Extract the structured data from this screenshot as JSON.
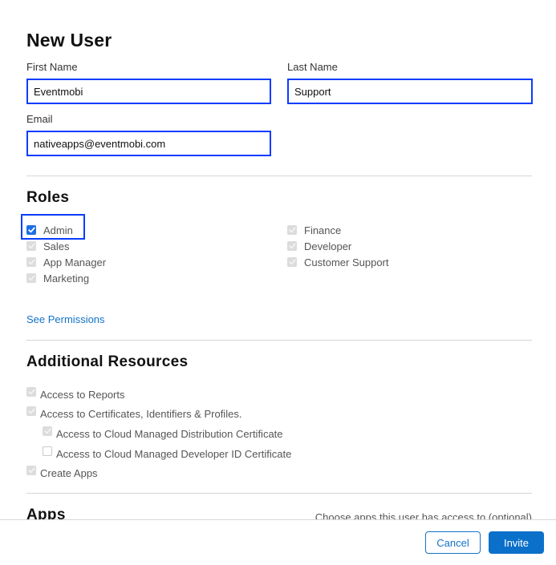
{
  "title": "New User",
  "form": {
    "first_name": {
      "label": "First Name",
      "value": "Eventmobi"
    },
    "last_name": {
      "label": "Last Name",
      "value": "Support"
    },
    "email": {
      "label": "Email",
      "value": "nativeapps@eventmobi.com"
    }
  },
  "roles": {
    "heading": "Roles",
    "left": [
      {
        "label": "Admin",
        "checked": true,
        "disabled": false,
        "focused": true
      },
      {
        "label": "Sales",
        "checked": true,
        "disabled": true
      },
      {
        "label": "App Manager",
        "checked": true,
        "disabled": true
      },
      {
        "label": "Marketing",
        "checked": true,
        "disabled": true
      }
    ],
    "right": [
      {
        "label": "Finance",
        "checked": true,
        "disabled": true
      },
      {
        "label": "Developer",
        "checked": true,
        "disabled": true
      },
      {
        "label": "Customer Support",
        "checked": true,
        "disabled": true
      }
    ],
    "see_permissions": "See Permissions"
  },
  "additional_resources": {
    "heading": "Additional Resources",
    "items": [
      {
        "label": "Access to Reports",
        "checked": true,
        "disabled": true,
        "indent": 0
      },
      {
        "label": "Access to Certificates, Identifiers & Profiles.",
        "checked": true,
        "disabled": true,
        "indent": 0
      },
      {
        "label": "Access to Cloud Managed Distribution Certificate",
        "checked": true,
        "disabled": true,
        "indent": 1
      },
      {
        "label": "Access to Cloud Managed Developer ID Certificate",
        "checked": false,
        "disabled": true,
        "indent": 1
      },
      {
        "label": "Create Apps",
        "checked": true,
        "disabled": true,
        "indent": 0
      }
    ]
  },
  "apps": {
    "heading": "Apps",
    "hint": "Choose apps this user has access to (optional)"
  },
  "footer": {
    "cancel_label": "Cancel",
    "invite_label": "Invite"
  },
  "colors": {
    "accent": "#0b70c9",
    "focus": "#0a3cff",
    "link": "#1573c7"
  }
}
